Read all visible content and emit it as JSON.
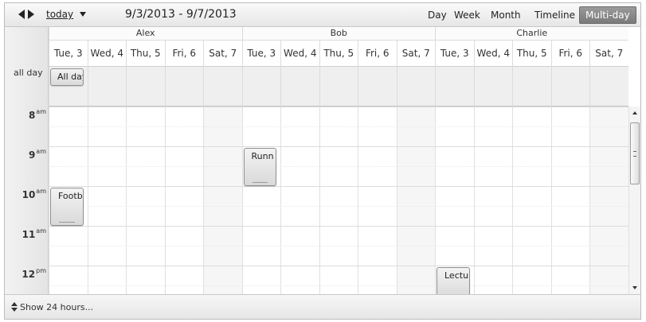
{
  "toolbar": {
    "prev_icon": "chevron-left-icon",
    "next_icon": "chevron-right-icon",
    "today_label": "today",
    "date_range": "9/3/2013 - 9/7/2013",
    "views": [
      {
        "label": "Day",
        "active": false
      },
      {
        "label": "Week",
        "active": false
      },
      {
        "label": "Month",
        "active": false
      },
      {
        "label": "Timeline",
        "active": false
      },
      {
        "label": "Multi-day",
        "active": true
      }
    ]
  },
  "resources": [
    {
      "name": "Alex"
    },
    {
      "name": "Bob"
    },
    {
      "name": "Charlie"
    }
  ],
  "days": [
    {
      "label": "Tue, 3",
      "weekend": false
    },
    {
      "label": "Wed, 4",
      "weekend": false
    },
    {
      "label": "Thu, 5",
      "weekend": false
    },
    {
      "label": "Fri, 6",
      "weekend": false
    },
    {
      "label": "Sat, 7",
      "weekend": true
    }
  ],
  "allday_label": "all day",
  "hours": [
    {
      "value": "8",
      "suffix": "am"
    },
    {
      "value": "9",
      "suffix": "am"
    },
    {
      "value": "10",
      "suffix": "am"
    },
    {
      "value": "11",
      "suffix": "am"
    },
    {
      "value": "12",
      "suffix": "pm"
    }
  ],
  "events": [
    {
      "title": "All day",
      "resource": 0,
      "day": 0,
      "allday": true
    },
    {
      "title": "Footb",
      "resource": 0,
      "day": 0,
      "allday": false
    },
    {
      "title": "Runn",
      "resource": 1,
      "day": 0,
      "allday": false
    },
    {
      "title": "Lectu",
      "resource": 2,
      "day": 0,
      "allday": false
    }
  ],
  "footer": {
    "icon": "expand-vertical-icon",
    "label": "Show 24 hours..."
  },
  "colors": {
    "active_view": "#888888",
    "weekend_column": "#f6f6f6",
    "allday_background": "#efefef"
  }
}
